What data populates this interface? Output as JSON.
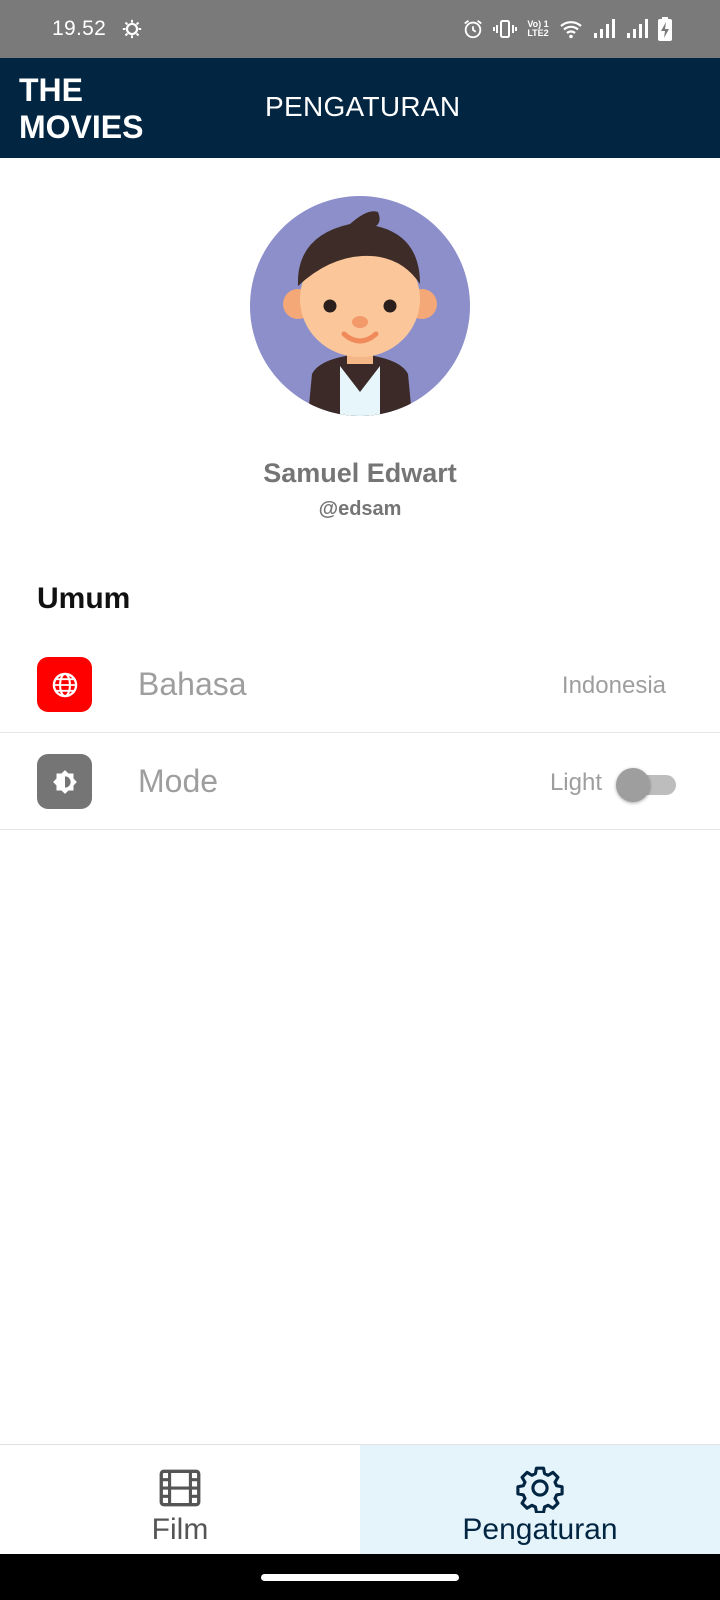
{
  "status_bar": {
    "time": "19.52",
    "icons": [
      "gear-icon",
      "alarm-icon",
      "vibrate-icon",
      "volte-lte2-icon",
      "wifi-icon",
      "signal-icon",
      "signal-icon",
      "battery-charging-icon"
    ],
    "volte_top": "Vo) 1",
    "volte_bottom": "LTE2"
  },
  "app_bar": {
    "logo_line1": "THE",
    "logo_line2": "MOVIES",
    "title": "PENGATURAN",
    "color": "#022542"
  },
  "profile": {
    "name": "Samuel Edwart",
    "handle": "@edsam",
    "avatar_icon": "user-avatar-illustration",
    "avatar_bg": "#8c8fca"
  },
  "section": {
    "title": "Umum",
    "items": [
      {
        "icon": "globe-icon",
        "icon_bg": "#ff0000",
        "label": "Bahasa",
        "value": "Indonesia"
      },
      {
        "icon": "brightness-icon",
        "icon_bg": "#757575",
        "label": "Mode",
        "value": "Light",
        "toggle_on": false
      }
    ]
  },
  "bottom_nav": {
    "items": [
      {
        "icon": "film-icon",
        "label": "Film",
        "active": false
      },
      {
        "icon": "settings-icon",
        "label": "Pengaturan",
        "active": true
      }
    ],
    "active_bg": "#e5f4fb"
  }
}
